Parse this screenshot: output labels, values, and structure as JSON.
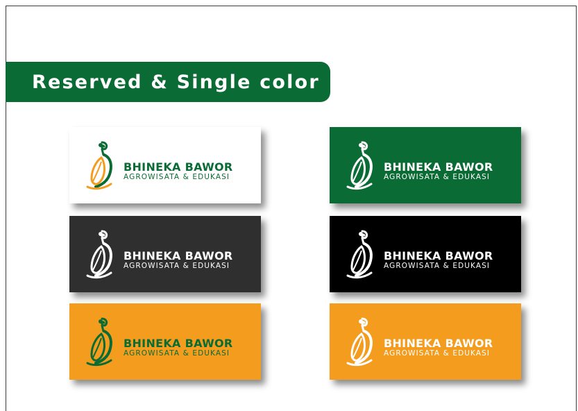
{
  "banner": {
    "title": "Reserved & Single color"
  },
  "logo": {
    "brand": "BHINEKA BAWOR",
    "tagline": "AGROWISATA & EDUKASI"
  },
  "colors": {
    "green": "#0b6b34",
    "orange": "#f39c1e",
    "dark_gray": "#2f2f2f",
    "black": "#000000",
    "white": "#ffffff"
  },
  "variants": [
    {
      "id": "white-full-color",
      "background": "#ffffff",
      "mark_green": "#0b6b34",
      "mark_orange": "#f39c1e",
      "brand_color": "#0b6b34",
      "tagline_color": "#0b6b34"
    },
    {
      "id": "green-reversed",
      "background": "#0b6b34",
      "mark_green": "#ffffff",
      "mark_orange": "#ffffff",
      "brand_color": "#ffffff",
      "tagline_color": "#ffffff"
    },
    {
      "id": "gray-reversed",
      "background": "#2f2f2f",
      "mark_green": "#ffffff",
      "mark_orange": "#ffffff",
      "brand_color": "#ffffff",
      "tagline_color": "#ffffff"
    },
    {
      "id": "black-reversed",
      "background": "#000000",
      "mark_green": "#ffffff",
      "mark_orange": "#ffffff",
      "brand_color": "#ffffff",
      "tagline_color": "#ffffff"
    },
    {
      "id": "orange-green-logo",
      "background": "#f39c1e",
      "mark_green": "#0b6b34",
      "mark_orange": "#0b6b34",
      "brand_color": "#0b6b34",
      "tagline_color": "#0b6b34"
    },
    {
      "id": "orange-reversed",
      "background": "#f39c1e",
      "mark_green": "#ffffff",
      "mark_orange": "#ffffff",
      "brand_color": "#ffffff",
      "tagline_color": "#ffffff"
    }
  ]
}
